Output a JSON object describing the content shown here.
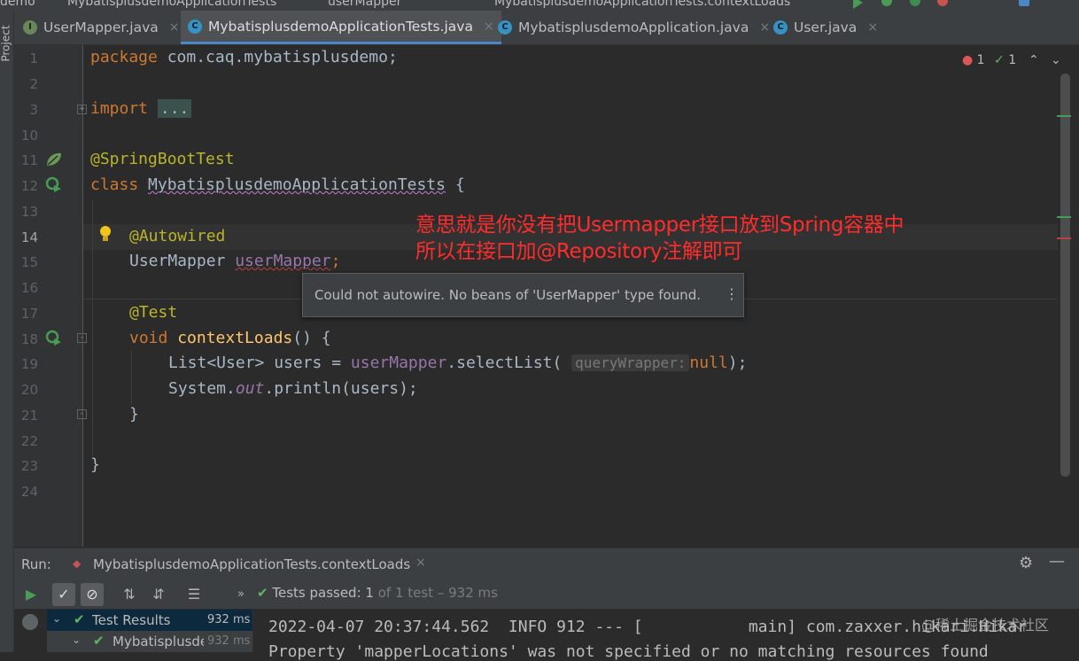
{
  "topbar": {
    "left_text": "demo",
    "crumb1": "MybatisplusdemoApplicationTests",
    "crumb2": "userMapper",
    "run_config": "MybatisplusdemoApplicationTests.contextLoads"
  },
  "left_stripe": {
    "project_label": "Project",
    "structure_label": "Structure"
  },
  "tabs": [
    {
      "label": "UserMapper.java",
      "icon": "interface-icon"
    },
    {
      "label": "MybatisplusdemoApplicationTests.java",
      "icon": "class-icon",
      "active": true
    },
    {
      "label": "MybatisplusdemoApplication.java",
      "icon": "class-icon"
    },
    {
      "label": "User.java",
      "icon": "class-icon"
    }
  ],
  "editor": {
    "line_numbers": [
      "1",
      "2",
      "3",
      "10",
      "11",
      "12",
      "13",
      "14",
      "15",
      "16",
      "17",
      "18",
      "19",
      "20",
      "21",
      "22",
      "23",
      "24"
    ],
    "code": {
      "l1_kw": "package",
      "l1_rest": " com.caq.mybatisplusdemo;",
      "l3_kw": "import",
      "l3_fold": "...",
      "l11": "@SpringBootTest",
      "l12_kw": "class",
      "l12_name": "MybatisplusdemoApplicationTests",
      "l12_rest": " {",
      "l14": "@Autowired",
      "l15_type": "UserMapper ",
      "l15_field": "userMapper",
      "l15_end": ";",
      "l17": "@Test",
      "l18_kw": "void",
      "l18_fn": "contextLoads",
      "l18_rest": "() {",
      "l19_a": "List<User> users = ",
      "l19_field": "userMapper",
      "l19_b": ".selectList( ",
      "l19_hint": "queryWrapper:",
      "l19_null": "null",
      "l19_c": ");",
      "l20_a": "System.",
      "l20_out": "out",
      "l20_b": ".println(users);",
      "l21": "}",
      "l23": "}"
    },
    "inspection": {
      "errors": "1",
      "checks": "1"
    }
  },
  "tooltip": {
    "text": "Could not autowire. No beans of 'UserMapper' type found."
  },
  "annotation": {
    "line1": "意思就是你没有把Usermapper接口放到Spring容器中",
    "line2": "所以在接口加@Repository注解即可"
  },
  "run_panel": {
    "label": "Run:",
    "tab_title": "MybatisplusdemoApplicationTests.contextLoads",
    "status_prefix": "Tests passed:",
    "status_count": "1",
    "status_rest": "of 1 test – 932 ms",
    "tree": [
      {
        "label": "Test Results",
        "time": "932 ms"
      },
      {
        "label": "Mybatisplusde",
        "time": "932 ms"
      }
    ],
    "console": [
      "2022-04-07 20:37:44.562  INFO 912 --- [           main] com.zaxxer.hikari.Hikar",
      "Property 'mapperLocations' was not specified or no matching resources found"
    ]
  },
  "watermark": "@稀土掘金技术社区"
}
